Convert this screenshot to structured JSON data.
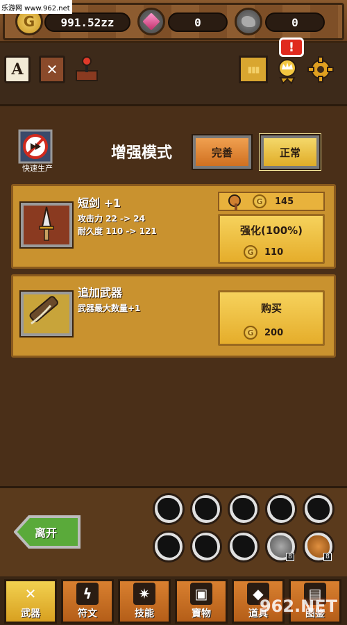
{
  "watermark": "乐游网 www.962.net",
  "resources": {
    "gold": "991.52zz",
    "gems": "0",
    "ore": "0",
    "gold_icon_letter": "G"
  },
  "toolbar": {
    "a_label": "A",
    "alert_mark": "!"
  },
  "panel": {
    "quick_produce_label": "快速生产",
    "mode_title": "增强模式",
    "mode_perfect": "完善",
    "mode_normal": "正常"
  },
  "sword_card": {
    "name": "短剑 +1",
    "attack_stat": "攻击力 22 -> 24",
    "durability_stat": "耐久度 110 -> 121",
    "extra_cost": "145",
    "enhance_label": "强化(100%)",
    "enhance_price": "110"
  },
  "add_weapon_card": {
    "name": "追加武器",
    "desc": "武器最大数量+1",
    "buy_label": "购买",
    "buy_price": "200"
  },
  "bottom": {
    "leave_label": "离开",
    "slot_count_a": "8",
    "slot_count_b": "8"
  },
  "tabs": [
    {
      "label": "武器"
    },
    {
      "label": "符文"
    },
    {
      "label": "技能"
    },
    {
      "label": "寶物"
    },
    {
      "label": "道具"
    },
    {
      "label": "图鉴"
    }
  ],
  "logo_text": "962.NET"
}
